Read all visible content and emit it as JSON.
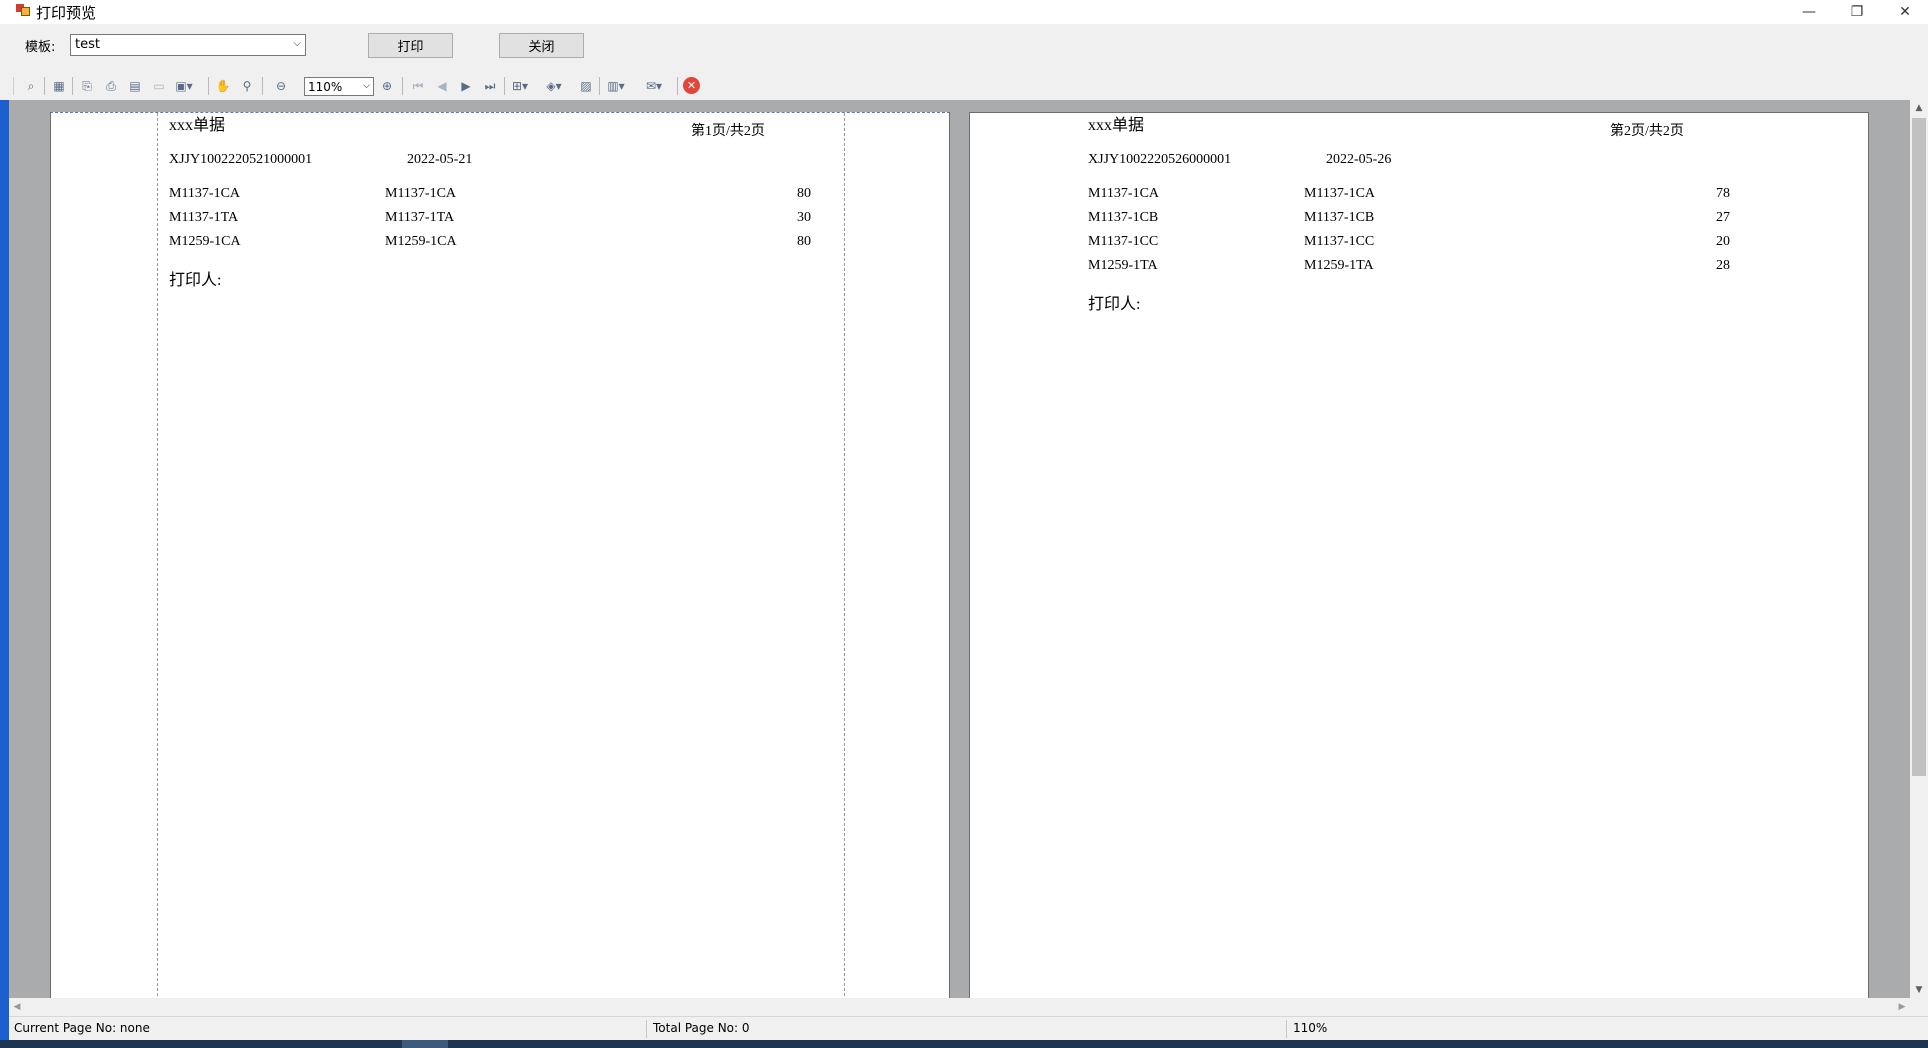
{
  "window": {
    "title": "打印预览",
    "minimize_glyph": "—",
    "restore_glyph": "❐",
    "close_glyph": "✕"
  },
  "controls": {
    "template_label": "模板:",
    "template_value": "test",
    "print_label": "打印",
    "close_label": "关闭"
  },
  "toolbar": {
    "zoom_value": "110%",
    "icons": [
      "find-icon",
      "grid-icon",
      "export-icon",
      "print-icon",
      "page-setup-icon",
      "scale-icon",
      "margins-icon",
      "hand-icon",
      "magnifier-icon",
      "zoom-out-icon",
      "zoom-in-icon",
      "first-page-icon",
      "prev-page-icon",
      "next-page-icon",
      "last-page-icon",
      "multipage-icon",
      "color-icon",
      "watermark-icon",
      "export-doc-icon",
      "email-icon",
      "close-preview-icon"
    ]
  },
  "pages": [
    {
      "title": "xxx单据",
      "page_info": "第1页/共2页",
      "doc_no": "XJJY1002220521000001",
      "date": "2022-05-21",
      "rows": [
        {
          "code": "M1137-1CA",
          "name": "M1137-1CA",
          "qty": "80"
        },
        {
          "code": "M1137-1TA",
          "name": "M1137-1TA",
          "qty": "30"
        },
        {
          "code": "M1259-1CA",
          "name": "M1259-1CA",
          "qty": "80"
        }
      ],
      "printer_label": "打印人:"
    },
    {
      "title": "xxx单据",
      "page_info": "第2页/共2页",
      "doc_no": "XJJY1002220526000001",
      "date": "2022-05-26",
      "rows": [
        {
          "code": "M1137-1CA",
          "name": "M1137-1CA",
          "qty": "78"
        },
        {
          "code": "M1137-1CB",
          "name": "M1137-1CB",
          "qty": "27"
        },
        {
          "code": "M1137-1CC",
          "name": "M1137-1CC",
          "qty": "20"
        },
        {
          "code": "M1259-1TA",
          "name": "M1259-1TA",
          "qty": "28"
        }
      ],
      "printer_label": "打印人:"
    }
  ],
  "status": {
    "current_page": "Current Page No: none",
    "total_page": "Total Page No: 0",
    "zoom": "110%"
  }
}
